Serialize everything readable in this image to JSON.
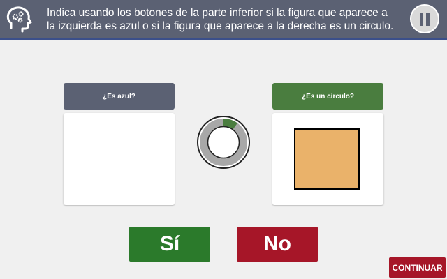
{
  "header": {
    "instruction": "Indica usando los botones de la parte inferior si la figura que aparece a la izquierda es azul o si la figura que aparece a la derecha es un circulo.",
    "logo_icon": "head-gears-icon",
    "pause_icon": "pause-icon"
  },
  "left_card": {
    "title": "¿Es azul?",
    "header_color": "#5b6173"
  },
  "right_card": {
    "title": "¿Es un circulo?",
    "header_color": "#4a7d3f",
    "shape": "square",
    "shape_color": "#eab26a"
  },
  "timer": {
    "progress": 0.1,
    "progress_color": "#4a7d3f",
    "track_color": "#a8a8a8"
  },
  "buttons": {
    "yes_label": "Sí",
    "yes_color": "#2b7a2b",
    "no_label": "No",
    "no_color": "#a61628",
    "continue_label": "CONTINUAR",
    "continue_color": "#a61628"
  }
}
